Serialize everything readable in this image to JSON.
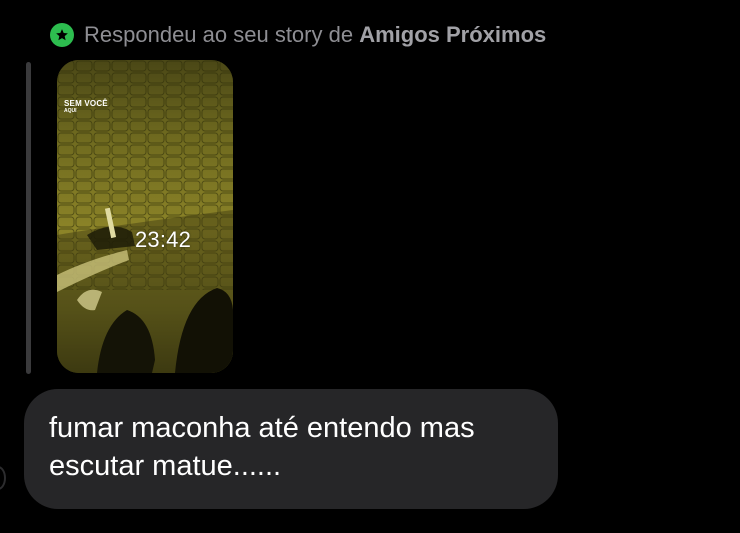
{
  "reply_header": {
    "icon": "star-icon",
    "icon_color": "#2dbd4f",
    "prefix": "Respondeu ao seu story de",
    "audience": "Amigos Próximos"
  },
  "story": {
    "caption_title": "SEM VOCÊ",
    "caption_sub": "AQUI",
    "timestamp": "23:42"
  },
  "message": {
    "text": "fumar maconha até entendo mas\nescutar matue......",
    "bubble_color": "#262628"
  }
}
